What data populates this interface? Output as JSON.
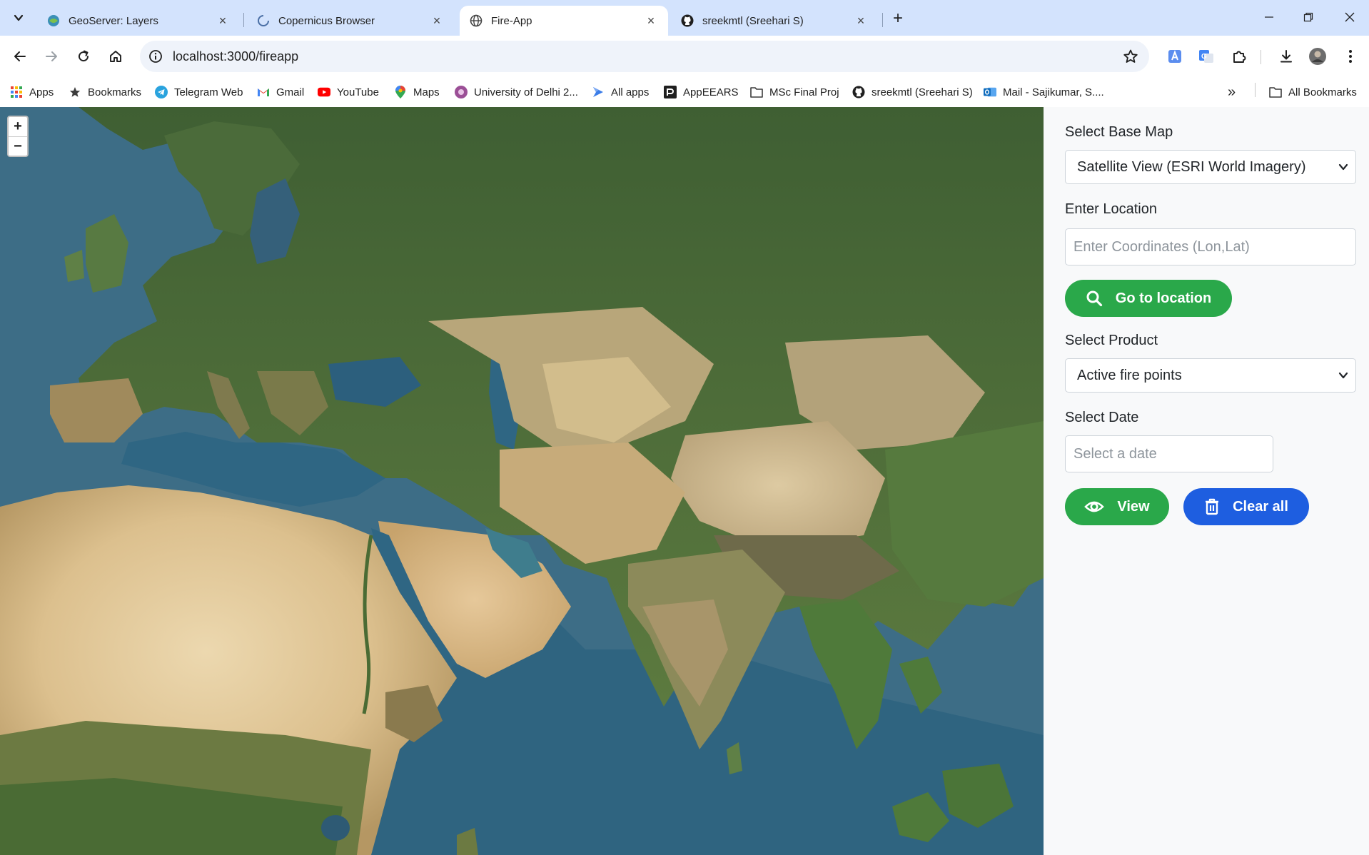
{
  "browser": {
    "tabs": [
      {
        "title": "GeoServer: Layers",
        "icon": "geoserver-icon",
        "active": false
      },
      {
        "title": "Copernicus Browser",
        "icon": "loading-spinner-icon",
        "active": false
      },
      {
        "title": "Fire-App",
        "icon": "globe-icon",
        "active": true
      },
      {
        "title": "sreekmtl (Sreehari S)",
        "icon": "github-icon",
        "active": false
      }
    ],
    "new_tab": "+",
    "url": "localhost:3000/fireapp",
    "bookmarks": [
      {
        "label": "Apps",
        "icon": "apps-grid-icon"
      },
      {
        "label": "Bookmarks",
        "icon": "star-icon"
      },
      {
        "label": "Telegram Web",
        "icon": "telegram-icon"
      },
      {
        "label": "Gmail",
        "icon": "gmail-icon"
      },
      {
        "label": "YouTube",
        "icon": "youtube-icon"
      },
      {
        "label": "Maps",
        "icon": "maps-pin-icon"
      },
      {
        "label": "University of Delhi 2...",
        "icon": "university-icon"
      },
      {
        "label": "All apps",
        "icon": "power-apps-icon"
      },
      {
        "label": "AppEEARS",
        "icon": "appeears-icon"
      },
      {
        "label": "MSc Final Proj",
        "icon": "folder-icon"
      },
      {
        "label": "sreekmtl (Sreehari S)",
        "icon": "github-icon"
      },
      {
        "label": "Mail - Sajikumar, S....",
        "icon": "outlook-icon"
      }
    ],
    "more_bookmarks": "»",
    "all_bookmarks": "All Bookmarks"
  },
  "map": {
    "zoom_in": "+",
    "zoom_out": "−",
    "colors": {
      "ocean": "#3d6d86",
      "forest": "#4a6a34",
      "steppe": "#8a8a58",
      "desert": "#d9bf8f",
      "sahara": "#e6cfa3"
    }
  },
  "panel": {
    "base_map_label": "Select Base Map",
    "base_map_value": "Satellite View (ESRI World Imagery)",
    "location_label": "Enter Location",
    "location_placeholder": "Enter Coordinates (Lon,Lat)",
    "go_button": "Go to location",
    "product_label": "Select Product",
    "product_value": "Active fire points",
    "date_label": "Select Date",
    "date_placeholder": "Select a date",
    "view_button": "View",
    "clear_button": "Clear all",
    "colors": {
      "green": "#2aa84a",
      "blue": "#1e5ee0"
    }
  }
}
